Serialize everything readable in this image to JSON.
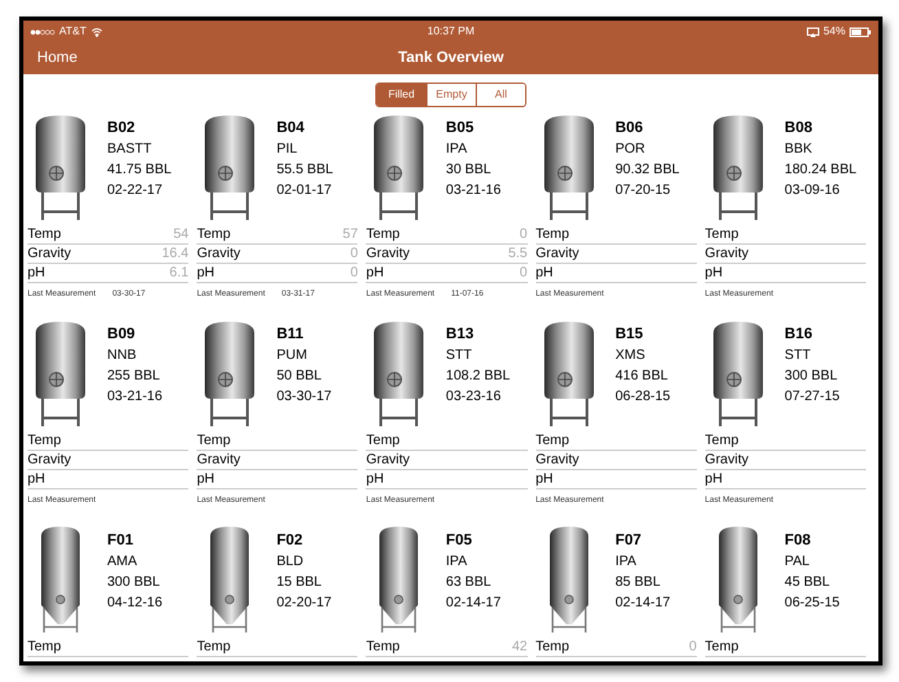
{
  "status_bar": {
    "carrier": "AT&T",
    "time": "10:37 PM",
    "battery": "54%"
  },
  "nav": {
    "back": "Home",
    "title": "Tank Overview"
  },
  "filter": [
    {
      "label": "Filled",
      "selected": true
    },
    {
      "label": "Empty",
      "selected": false
    },
    {
      "label": "All",
      "selected": false
    }
  ],
  "tanks": [
    {
      "kind": "brite",
      "id": "B02",
      "style": "BASTT",
      "volume": "41.75 BBL",
      "date": "02-22-17",
      "readings": [
        {
          "label": "Temp",
          "value": "54"
        },
        {
          "label": "Gravity",
          "value": "16.4"
        },
        {
          "label": "pH",
          "value": "6.1"
        }
      ],
      "last_measurement": {
        "label": "Last Measurement",
        "date": "03-30-17"
      }
    },
    {
      "kind": "brite",
      "id": "B04",
      "style": "PIL",
      "volume": "55.5 BBL",
      "date": "02-01-17",
      "readings": [
        {
          "label": "Temp",
          "value": "57"
        },
        {
          "label": "Gravity",
          "value": "0"
        },
        {
          "label": "pH",
          "value": "0"
        }
      ],
      "last_measurement": {
        "label": "Last Measurement",
        "date": "03-31-17"
      }
    },
    {
      "kind": "brite",
      "id": "B05",
      "style": "IPA",
      "volume": "30 BBL",
      "date": "03-21-16",
      "readings": [
        {
          "label": "Temp",
          "value": "0"
        },
        {
          "label": "Gravity",
          "value": "5.5"
        },
        {
          "label": "pH",
          "value": "0"
        }
      ],
      "last_measurement": {
        "label": "Last Measurement",
        "date": "11-07-16"
      }
    },
    {
      "kind": "brite",
      "id": "B06",
      "style": "POR",
      "volume": "90.32 BBL",
      "date": "07-20-15",
      "readings": [
        {
          "label": "Temp"
        },
        {
          "label": "Gravity"
        },
        {
          "label": "pH"
        }
      ],
      "last_measurement": {
        "label": "Last Measurement"
      }
    },
    {
      "kind": "brite",
      "id": "B08",
      "style": "BBK",
      "volume": "180.24 BBL",
      "date": "03-09-16",
      "readings": [
        {
          "label": "Temp"
        },
        {
          "label": "Gravity"
        },
        {
          "label": "pH"
        }
      ],
      "last_measurement": {
        "label": "Last Measurement"
      }
    },
    {
      "kind": "brite",
      "id": "B09",
      "style": "NNB",
      "volume": "255 BBL",
      "date": "03-21-16",
      "readings": [
        {
          "label": "Temp"
        },
        {
          "label": "Gravity"
        },
        {
          "label": "pH"
        }
      ],
      "last_measurement": {
        "label": "Last Measurement"
      }
    },
    {
      "kind": "brite",
      "id": "B11",
      "style": "PUM",
      "volume": "50 BBL",
      "date": "03-30-17",
      "readings": [
        {
          "label": "Temp"
        },
        {
          "label": "Gravity"
        },
        {
          "label": "pH"
        }
      ],
      "last_measurement": {
        "label": "Last Measurement"
      }
    },
    {
      "kind": "brite",
      "id": "B13",
      "style": "STT",
      "volume": "108.2 BBL",
      "date": "03-23-16",
      "readings": [
        {
          "label": "Temp"
        },
        {
          "label": "Gravity"
        },
        {
          "label": "pH"
        }
      ],
      "last_measurement": {
        "label": "Last Measurement"
      }
    },
    {
      "kind": "brite",
      "id": "B15",
      "style": "XMS",
      "volume": "416 BBL",
      "date": "06-28-15",
      "readings": [
        {
          "label": "Temp"
        },
        {
          "label": "Gravity"
        },
        {
          "label": "pH"
        }
      ],
      "last_measurement": {
        "label": "Last Measurement"
      }
    },
    {
      "kind": "brite",
      "id": "B16",
      "style": "STT",
      "volume": "300 BBL",
      "date": "07-27-15",
      "readings": [
        {
          "label": "Temp"
        },
        {
          "label": "Gravity"
        },
        {
          "label": "pH"
        }
      ],
      "last_measurement": {
        "label": "Last Measurement"
      }
    },
    {
      "kind": "fermenter",
      "id": "F01",
      "style": "AMA",
      "volume": "300 BBL",
      "date": "04-12-16",
      "readings": [
        {
          "label": "Temp"
        }
      ]
    },
    {
      "kind": "fermenter",
      "id": "F02",
      "style": "BLD",
      "volume": "15 BBL",
      "date": "02-20-17",
      "readings": [
        {
          "label": "Temp"
        }
      ]
    },
    {
      "kind": "fermenter",
      "id": "F05",
      "style": "IPA",
      "volume": "63 BBL",
      "date": "02-14-17",
      "readings": [
        {
          "label": "Temp",
          "value": "42"
        }
      ]
    },
    {
      "kind": "fermenter",
      "id": "F07",
      "style": "IPA",
      "volume": "85 BBL",
      "date": "02-14-17",
      "readings": [
        {
          "label": "Temp",
          "value": "0"
        }
      ]
    },
    {
      "kind": "fermenter",
      "id": "F08",
      "style": "PAL",
      "volume": "45 BBL",
      "date": "06-25-15",
      "readings": [
        {
          "label": "Temp"
        }
      ]
    }
  ]
}
